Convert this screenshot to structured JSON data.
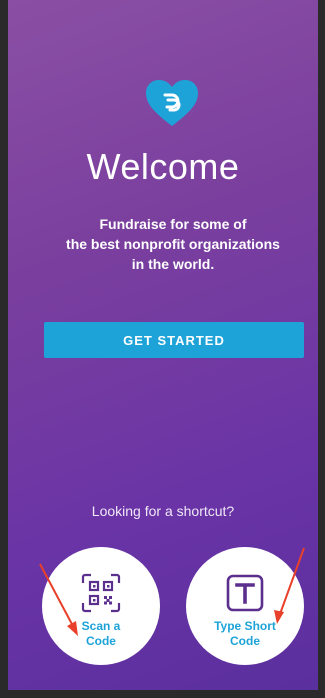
{
  "welcome": {
    "title": "Welcome",
    "tagline_lines": [
      "Fundraise for some of",
      "the best nonprofit organizations",
      "in the world."
    ],
    "cta_label": "GET STARTED"
  },
  "shortcut": {
    "prompt": "Looking for a shortcut?",
    "scan": {
      "line1": "Scan a",
      "line2": "Code",
      "icon": "qr-code-icon"
    },
    "type": {
      "line1": "Type Short",
      "line2": "Code",
      "icon": "t-box-icon"
    }
  },
  "colors": {
    "accent": "#1ea3d8",
    "background_top": "#8a4fa4",
    "background_bottom": "#5a2f9e",
    "icon": "#5a2f8e",
    "annotation_arrow": "#e8402a"
  }
}
